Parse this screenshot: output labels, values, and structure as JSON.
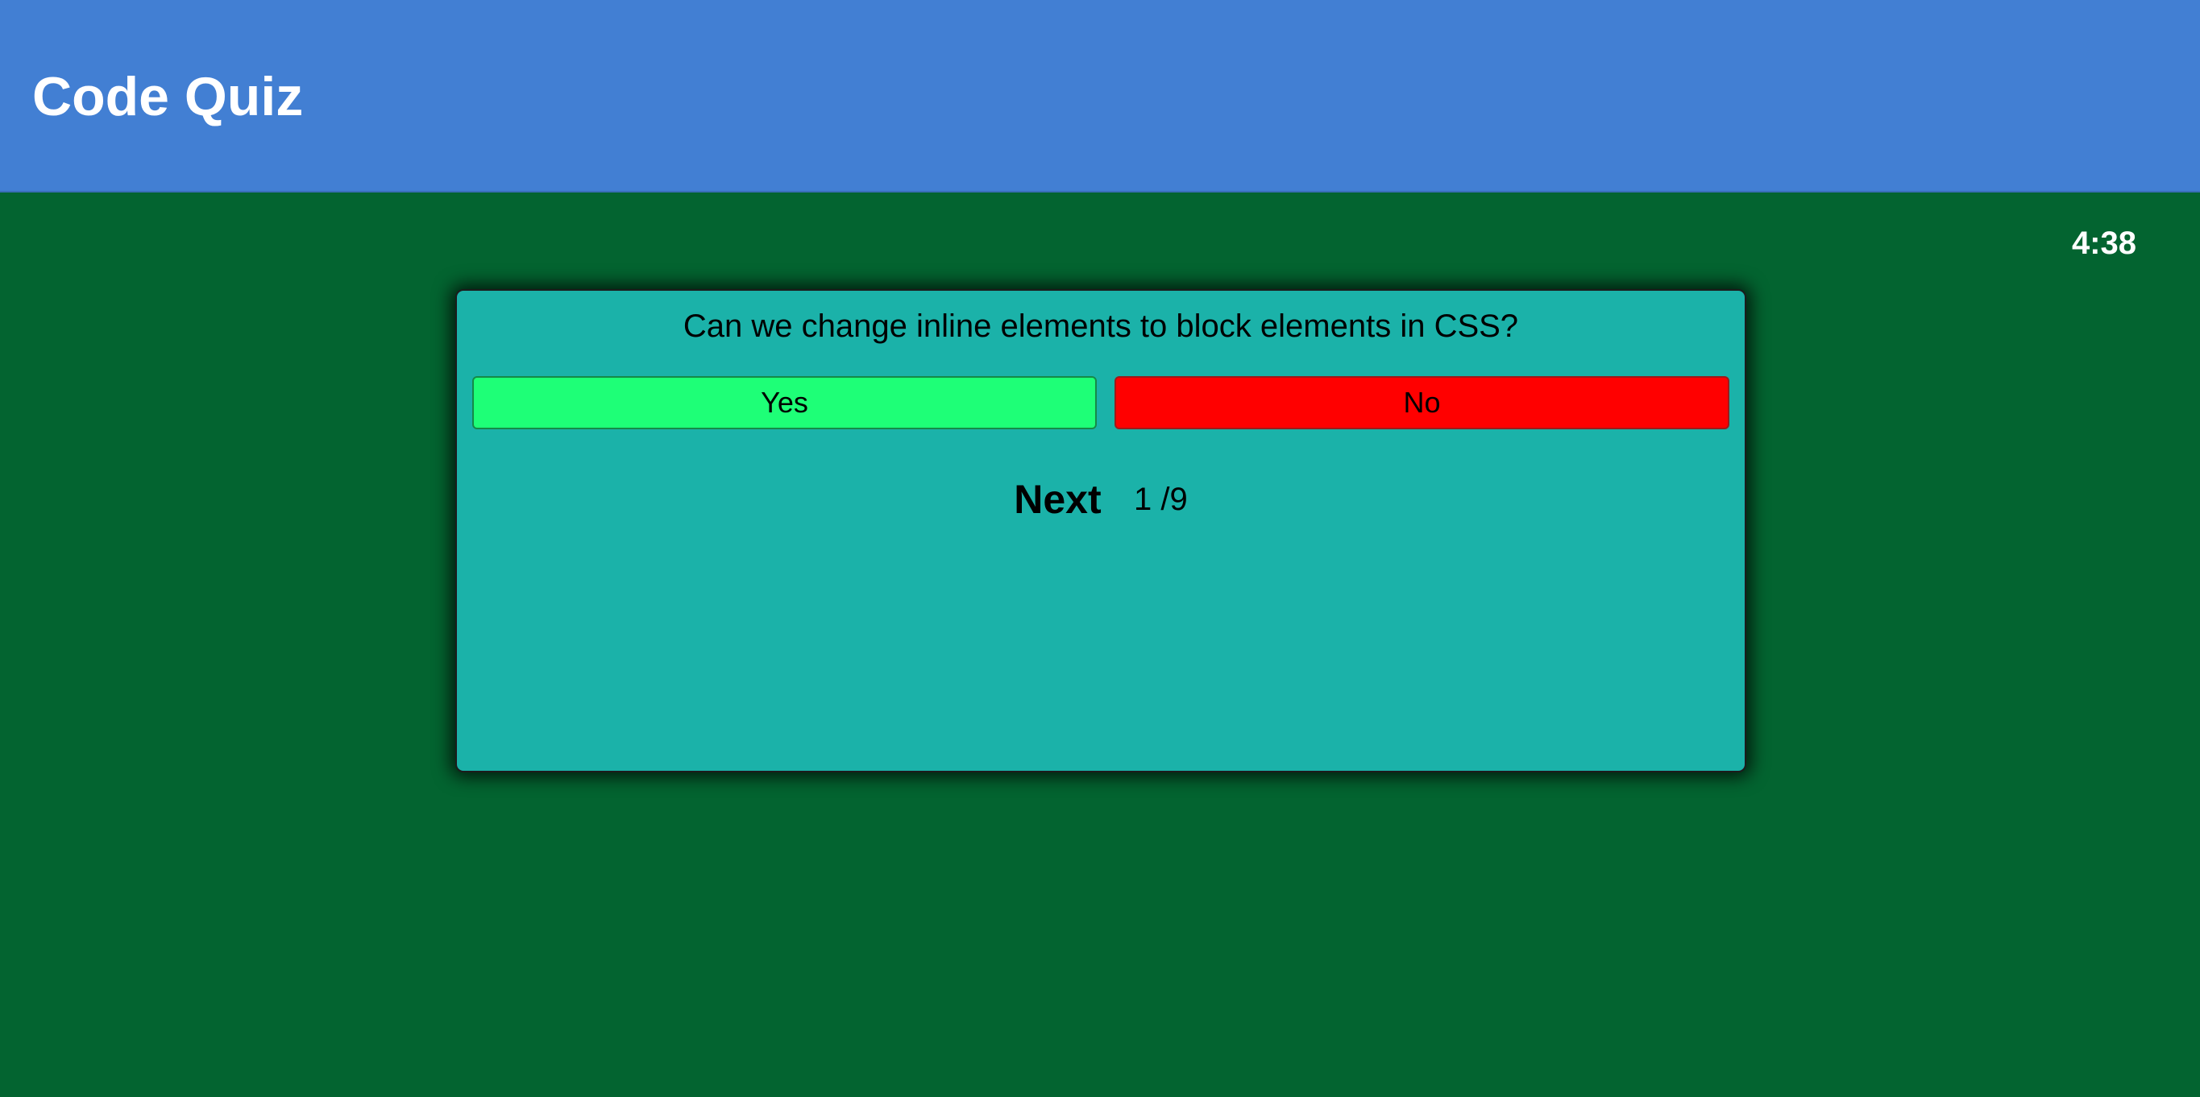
{
  "header": {
    "title": "Code Quiz"
  },
  "timer": {
    "value": "4:38"
  },
  "quiz": {
    "question": "Can we change inline elements to block elements in CSS?",
    "answers": [
      {
        "label": "Yes",
        "color": "#1eff77"
      },
      {
        "label": "No",
        "color": "#ff0000"
      }
    ],
    "next_label": "Next",
    "progress": "1 /9"
  },
  "colors": {
    "header_bg": "#427fd3",
    "page_bg": "#036430",
    "card_bg": "#1bb2a9"
  }
}
